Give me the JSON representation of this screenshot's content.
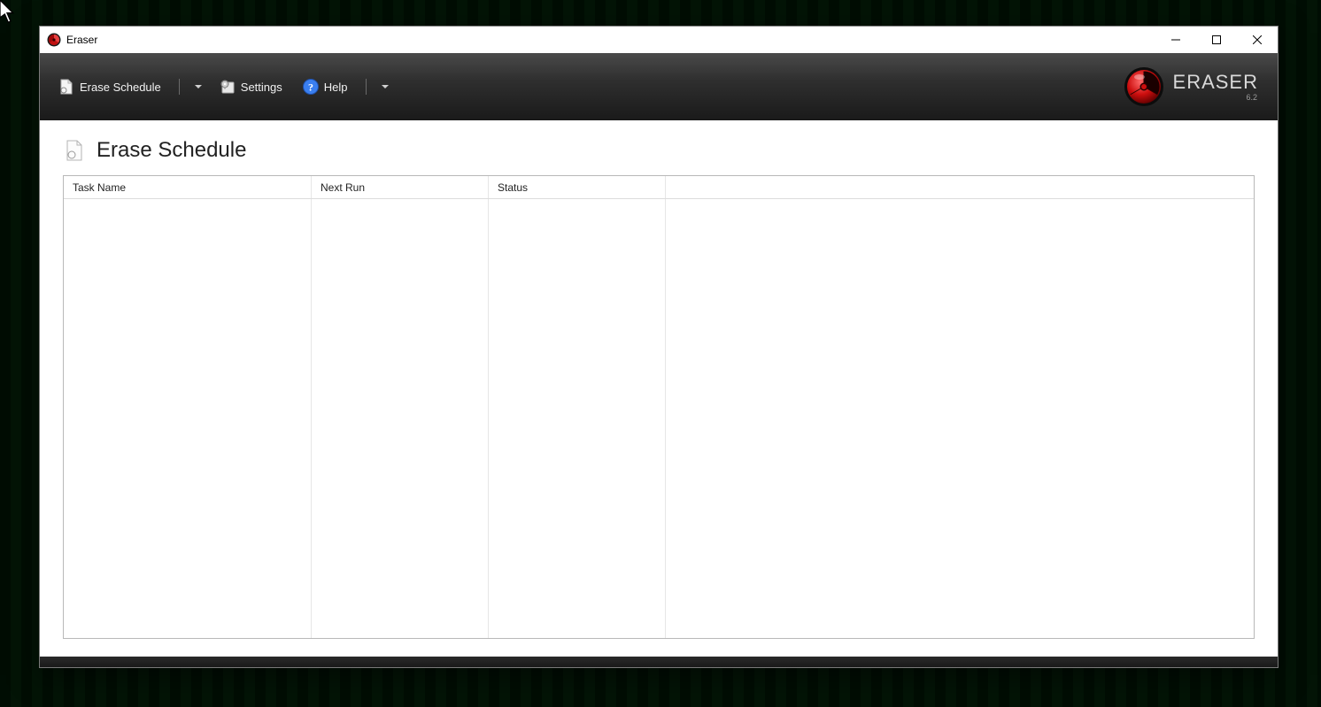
{
  "window": {
    "title": "Eraser"
  },
  "toolbar": {
    "eraseSchedule": "Erase Schedule",
    "settings": "Settings",
    "help": "Help"
  },
  "brand": {
    "name": "ERASER",
    "version": "6.2"
  },
  "page": {
    "title": "Erase Schedule"
  },
  "columns": {
    "taskName": "Task Name",
    "nextRun": "Next Run",
    "status": "Status"
  }
}
